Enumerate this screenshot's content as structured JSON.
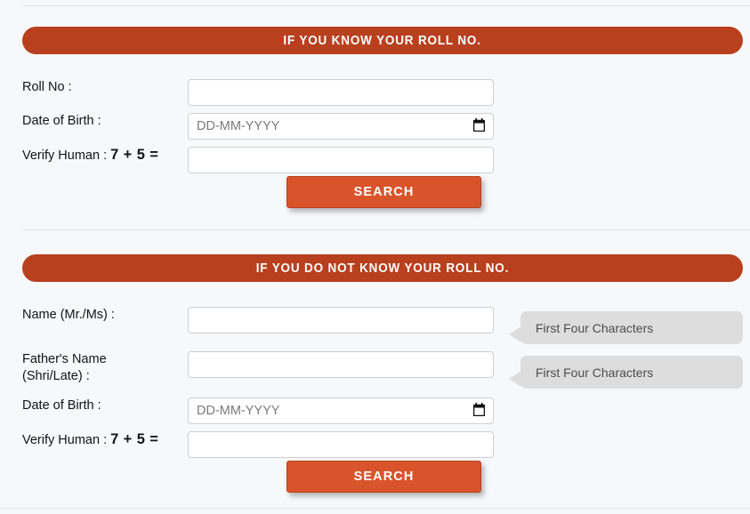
{
  "page": {
    "background_color": "#f7f8fa",
    "banner_color": "#b8401f",
    "button_color": "#d9542b",
    "tooltip_color": "#dddddd"
  },
  "section_known": {
    "banner_title": "IF YOU KNOW YOUR ROLL NO.",
    "fields": {
      "roll_no_label": "Roll No :",
      "roll_no_value": "",
      "dob_label": "Date of Birth :",
      "dob_placeholder": "DD-MM-YYYY",
      "dob_value": "",
      "verify_label": "Verify Human :",
      "verify_math": "7 + 5 =",
      "verify_value": ""
    },
    "search_label": "SEARCH"
  },
  "section_unknown": {
    "banner_title": "IF YOU DO NOT KNOW YOUR ROLL NO.",
    "fields": {
      "name_label": "Name (Mr./Ms) :",
      "name_value": "",
      "name_hint": "First Four Characters",
      "father_label": "Father's Name (Shri/Late) :",
      "father_value": "",
      "father_hint": "First Four Characters",
      "dob_label": "Date of Birth :",
      "dob_placeholder": "DD-MM-YYYY",
      "dob_value": "",
      "verify_label": "Verify Human :",
      "verify_math": "7 + 5 =",
      "verify_value": ""
    },
    "search_label": "SEARCH"
  },
  "icons": {
    "calendar": "calendar-icon"
  }
}
